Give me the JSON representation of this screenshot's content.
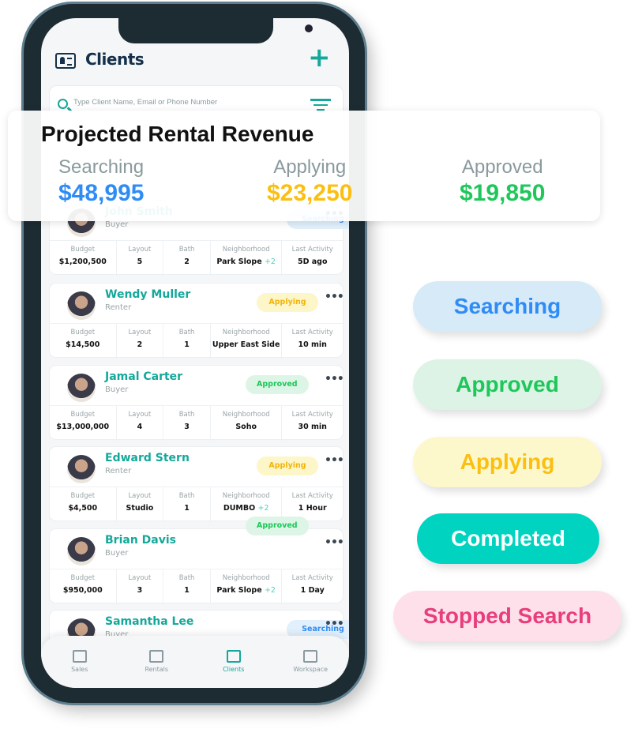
{
  "header": {
    "title": "Clients",
    "add_icon": "plus-icon",
    "icon": "id-card-icon"
  },
  "search": {
    "placeholder": "Type Client Name, Email or Phone Number"
  },
  "stat_labels": [
    "Budget",
    "Layout",
    "Bath",
    "Neighborhood",
    "Last Activity"
  ],
  "colors": {
    "accent": "#14a89a",
    "searching": "#2f8cf5",
    "applying": "#fbbf12",
    "approved": "#1ec75a",
    "completed": "#00d3c0",
    "stopped": "#e83e7b"
  },
  "clients": [
    {
      "name": "John Smith",
      "role": "Buyer",
      "status": "Searching",
      "budget": "$1,200,500",
      "layout": "5",
      "bath": "2",
      "neighborhood": "Park Slope",
      "extra": "+2",
      "activity": "5D ago"
    },
    {
      "name": "Wendy Muller",
      "role": "Renter",
      "status": "Applying",
      "budget": "$14,500",
      "layout": "2",
      "bath": "1",
      "neighborhood": "Upper East Side",
      "extra": "",
      "activity": "10 min"
    },
    {
      "name": "Jamal Carter",
      "role": "Buyer",
      "status": "Approved",
      "budget": "$13,000,000",
      "layout": "4",
      "bath": "3",
      "neighborhood": "Soho",
      "extra": "",
      "activity": "30 min"
    },
    {
      "name": "Edward Stern",
      "role": "Renter",
      "status": "Applying",
      "budget": "$4,500",
      "layout": "Studio",
      "bath": "1",
      "neighborhood": "DUMBO",
      "extra": "+2",
      "activity": "1 Hour"
    },
    {
      "name": "Brian Davis",
      "role": "Buyer",
      "status": "Approved",
      "budget": "$950,000",
      "layout": "3",
      "bath": "1",
      "neighborhood": "Park Slope",
      "extra": "+2",
      "activity": "1 Day"
    },
    {
      "name": "Samantha Lee",
      "role": "Buyer",
      "status": "Searching",
      "budget": "",
      "layout": "",
      "bath": "",
      "neighborhood": "",
      "extra": "",
      "activity": ""
    }
  ],
  "tabs": [
    {
      "label": "Sales",
      "icon": "home-icon"
    },
    {
      "label": "Rentals",
      "icon": "rental-icon"
    },
    {
      "label": "Clients",
      "icon": "id-card-icon",
      "active": true
    },
    {
      "label": "Workspace",
      "icon": "workspace-icon"
    }
  ],
  "revenue": {
    "title": "Projected Rental Revenue",
    "items": [
      {
        "label": "Searching",
        "value": "$48,995"
      },
      {
        "label": "Applying",
        "value": "$23,250"
      },
      {
        "label": "Approved",
        "value": "$19,850"
      }
    ]
  },
  "status_pills": [
    "Searching",
    "Approved",
    "Applying",
    "Completed",
    "Stopped Search"
  ]
}
